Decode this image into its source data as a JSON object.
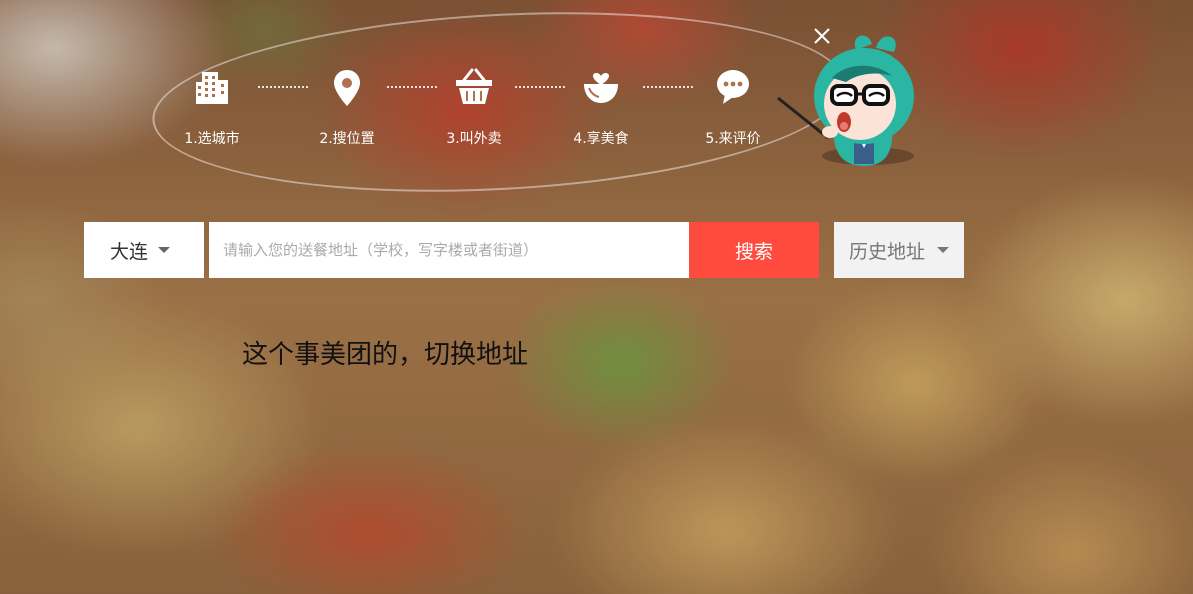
{
  "guide": {
    "steps": [
      {
        "label": "1.选城市",
        "icon": "building-icon"
      },
      {
        "label": "2.搜位置",
        "icon": "location-pin-icon"
      },
      {
        "label": "3.叫外卖",
        "icon": "basket-icon"
      },
      {
        "label": "4.享美食",
        "icon": "bowl-icon"
      },
      {
        "label": "5.来评价",
        "icon": "chat-bubble-icon"
      }
    ]
  },
  "close": {
    "icon": "close-icon"
  },
  "mascot": {
    "icon": "mascot-teacher-icon"
  },
  "search": {
    "city": "大连",
    "placeholder": "请输入您的送餐地址（学校，写字楼或者街道）",
    "value": "",
    "button_label": "搜索",
    "history_label": "历史地址"
  },
  "annotation": "这个事美团的，切换地址",
  "colors": {
    "accent": "#ff4b3e",
    "history_bg": "#f2f2f2",
    "mascot_teal": "#2bb5a3"
  }
}
